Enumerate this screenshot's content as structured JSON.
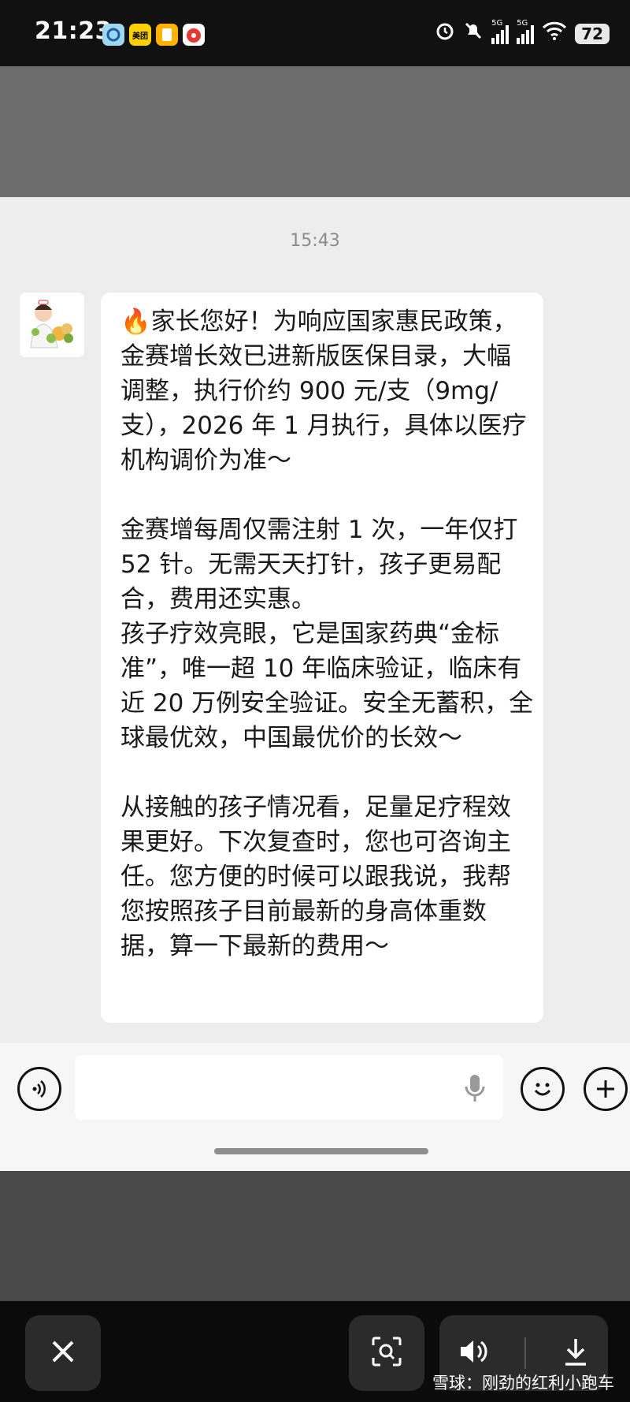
{
  "status_bar": {
    "time": "21:23",
    "app_icons": [
      "qq-browser-icon",
      "meituan-icon",
      "notes-icon",
      "clown-app-icon"
    ],
    "meituan_label": "美团",
    "signal_label_1": "5G",
    "signal_label_2": "5G",
    "battery": "72"
  },
  "chat": {
    "timestamp": "15:43",
    "message": "🔥家长您好！为响应国家惠民政策，金赛增长效已进新版医保目录，大幅调整，执行价约 900 元/支（9mg/支），2026 年 1 月执行，具体以医疗机构调价为准～\n\n金赛增每周仅需注射 1 次，一年仅打 52 针。无需天天打针，孩子更易配合，费用还实惠。\n孩子疗效亮眼，它是国家药典“金标准”，唯一超 10 年临床验证，临床有近 20 万例安全验证。安全无蓄积，全球最优效，中国最优价的长效～\n\n从接触的孩子情况看，足量足疗程效果更好。下次复查时，您也可咨询主任。您方便的时候可以跟我说，我帮您按照孩子目前最新的身高体重数据，算一下最新的费用～"
  },
  "input_bar": {
    "voice_icon": "voice-wave-icon",
    "mic_icon": "microphone-icon",
    "emoji_icon": "smile-icon",
    "plus_icon": "plus-icon"
  },
  "toolbar": {
    "close_icon": "close-icon",
    "scan_icon": "scan-icon",
    "sound_icon": "speaker-icon",
    "download_icon": "download-icon"
  },
  "watermark": "雪球：刚劲的红利小跑车"
}
